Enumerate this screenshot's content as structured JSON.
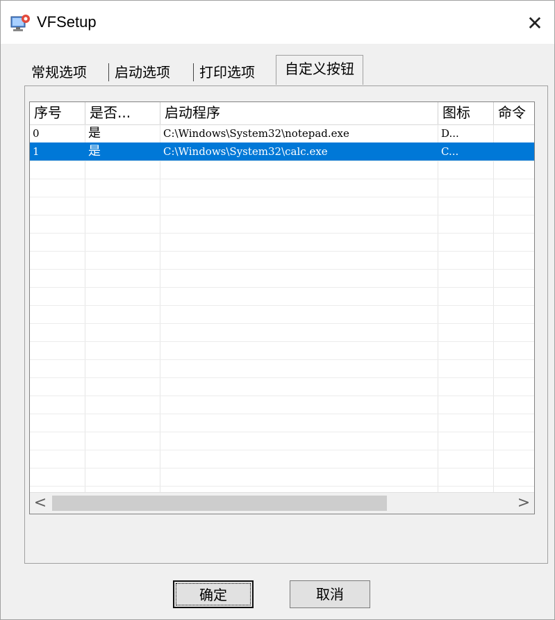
{
  "window": {
    "title": "VFSetup"
  },
  "tabs": [
    {
      "label": "常规选项"
    },
    {
      "label": "启动选项"
    },
    {
      "label": "打印选项"
    },
    {
      "label": "自定义按钮",
      "active": true
    }
  ],
  "list": {
    "columns": [
      "序号",
      "是否...",
      "启动程序",
      "图标",
      "命令"
    ],
    "rows": [
      {
        "index": "0",
        "enabled": "是",
        "program": "C:\\Windows\\System32\\notepad.exe",
        "icon": "D...",
        "command": "",
        "selected": false
      },
      {
        "index": "1",
        "enabled": "是",
        "program": "C:\\Windows\\System32\\calc.exe",
        "icon": "C...",
        "command": "",
        "selected": true
      }
    ]
  },
  "scrollbar": {
    "left_arrow": "<",
    "right_arrow": ">"
  },
  "buttons": {
    "ok": "确定",
    "cancel": "取消"
  },
  "colors": {
    "selection": "#0078d7"
  },
  "icons": {
    "app": "app-computer-icon",
    "close": "close-icon"
  }
}
